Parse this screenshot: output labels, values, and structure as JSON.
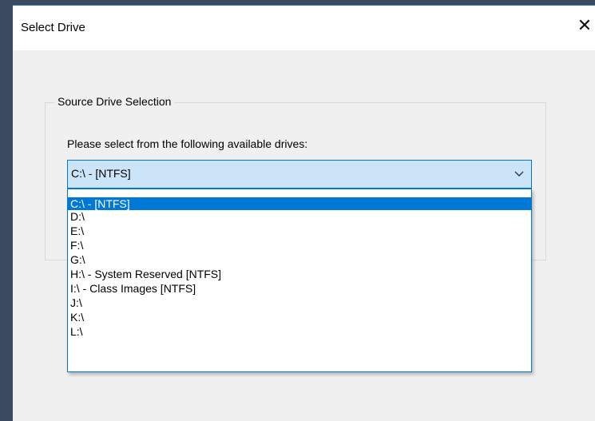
{
  "dialog": {
    "title": "Select Drive",
    "close_glyph": "✕"
  },
  "group": {
    "legend": "Source Drive Selection",
    "prompt": "Please select from the following available drives:"
  },
  "combo": {
    "selected_value": "C:\\ -  [NTFS]",
    "arrow_icon": "chevron-down-icon"
  },
  "options": [
    {
      "label": "C:\\ -  [NTFS]",
      "selected": true
    },
    {
      "label": "D:\\",
      "selected": false
    },
    {
      "label": "E:\\",
      "selected": false
    },
    {
      "label": "F:\\",
      "selected": false
    },
    {
      "label": "G:\\",
      "selected": false
    },
    {
      "label": "H:\\ - System Reserved [NTFS]",
      "selected": false
    },
    {
      "label": "I:\\ - Class Images [NTFS]",
      "selected": false
    },
    {
      "label": "J:\\",
      "selected": false
    },
    {
      "label": "K:\\",
      "selected": false
    },
    {
      "label": "L:\\",
      "selected": false
    }
  ],
  "colors": {
    "accent": "#0078d7",
    "combo_bg": "#cce4f7",
    "dialog_bg": "#f0f0f0",
    "backdrop": "#3c4a60"
  }
}
